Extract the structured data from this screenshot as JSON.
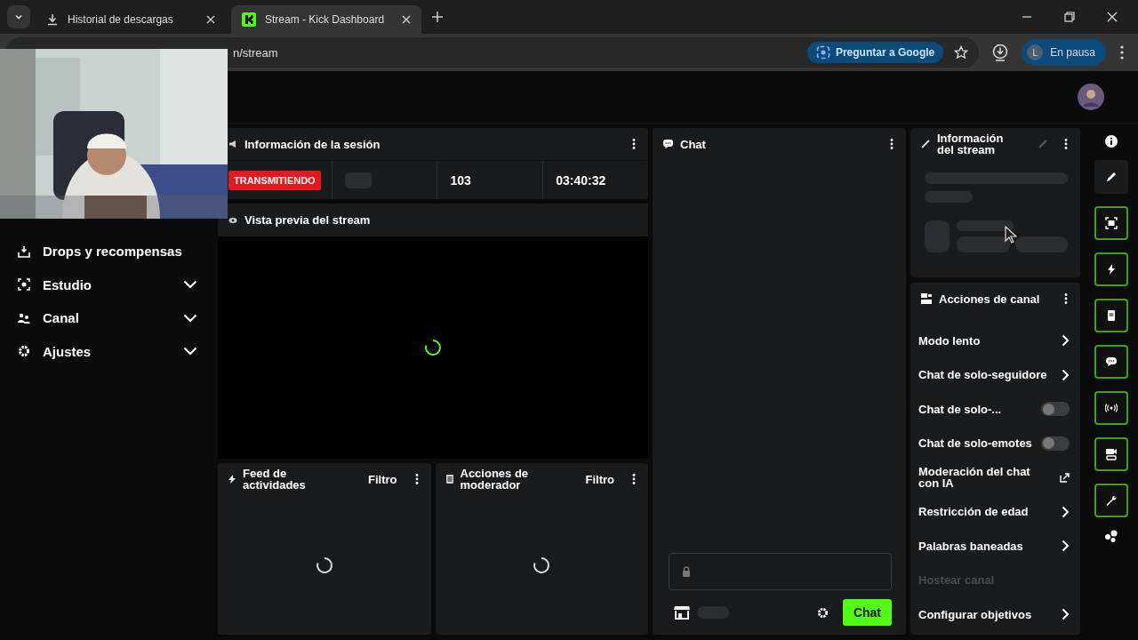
{
  "browser": {
    "tabs": [
      {
        "title": "Historial de descargas",
        "kind": "download",
        "selected": false
      },
      {
        "title": "Stream - Kick Dashboard",
        "kind": "kick",
        "selected": true
      }
    ],
    "address": "n/stream",
    "ask_button": "Preguntar a Google",
    "profile": {
      "initial": "L",
      "status": "En pausa"
    }
  },
  "sidebar": {
    "items": [
      {
        "label": "Drops y recompensas",
        "kind": "link"
      },
      {
        "label": "Estudio",
        "kind": "group"
      },
      {
        "label": "Canal",
        "kind": "group"
      },
      {
        "label": "Ajustes",
        "kind": "group"
      }
    ]
  },
  "session": {
    "title": "Información de la sesión",
    "status": "TRANSMITIENDO",
    "viewers": "103",
    "uptime": "03:40:32"
  },
  "preview": {
    "title": "Vista previa del stream"
  },
  "feed": {
    "title": "Feed de actividades",
    "filter": "Filtro"
  },
  "moderator": {
    "title": "Acciones de moderador",
    "filter": "Filtro"
  },
  "chat": {
    "title": "Chat",
    "send": "Chat"
  },
  "stream_info": {
    "title": "Información del stream"
  },
  "channel_actions": {
    "title": "Acciones de canal",
    "items": [
      {
        "label": "Modo lento",
        "kind": "chevron",
        "disabled": false
      },
      {
        "label": "Chat de solo-seguidore",
        "kind": "chevron",
        "disabled": false
      },
      {
        "label": "Chat de solo-...",
        "kind": "toggle",
        "on": false,
        "disabled": false
      },
      {
        "label": "Chat de solo-emotes",
        "kind": "toggle",
        "on": false,
        "disabled": false
      },
      {
        "label": "Moderación del chat con IA",
        "kind": "external",
        "disabled": false
      },
      {
        "label": "Restricción de edad",
        "kind": "chevron",
        "disabled": false
      },
      {
        "label": "Palabras baneadas",
        "kind": "chevron",
        "disabled": false
      },
      {
        "label": "Hostear canal",
        "kind": "plain",
        "disabled": true
      },
      {
        "label": "Configurar objetivos",
        "kind": "chevron",
        "disabled": false
      }
    ]
  }
}
